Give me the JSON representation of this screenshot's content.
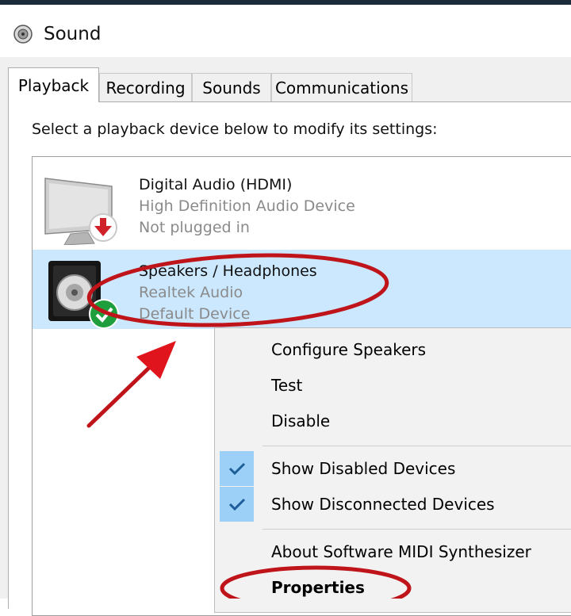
{
  "window": {
    "title": "Sound"
  },
  "tabs": [
    {
      "label": "Playback"
    },
    {
      "label": "Recording"
    },
    {
      "label": "Sounds"
    },
    {
      "label": "Communications"
    }
  ],
  "instruction": "Select a playback device below to modify its settings:",
  "devices": [
    {
      "name": "Digital Audio (HDMI)",
      "driver": "High Definition Audio Device",
      "status": "Not plugged in"
    },
    {
      "name": "Speakers / Headphones",
      "driver": "Realtek Audio",
      "status": "Default Device"
    }
  ],
  "context_menu": {
    "items": [
      {
        "label": "Configure Speakers"
      },
      {
        "label": "Test"
      },
      {
        "label": "Disable"
      },
      {
        "label": "Show Disabled Devices",
        "checked": true
      },
      {
        "label": "Show Disconnected Devices",
        "checked": true
      },
      {
        "label": "About Software MIDI Synthesizer"
      },
      {
        "label": "Properties"
      }
    ]
  },
  "colors": {
    "selection": "#cce8ff",
    "annotation": "#c0141b",
    "check_highlight": "#9dd0f7"
  }
}
